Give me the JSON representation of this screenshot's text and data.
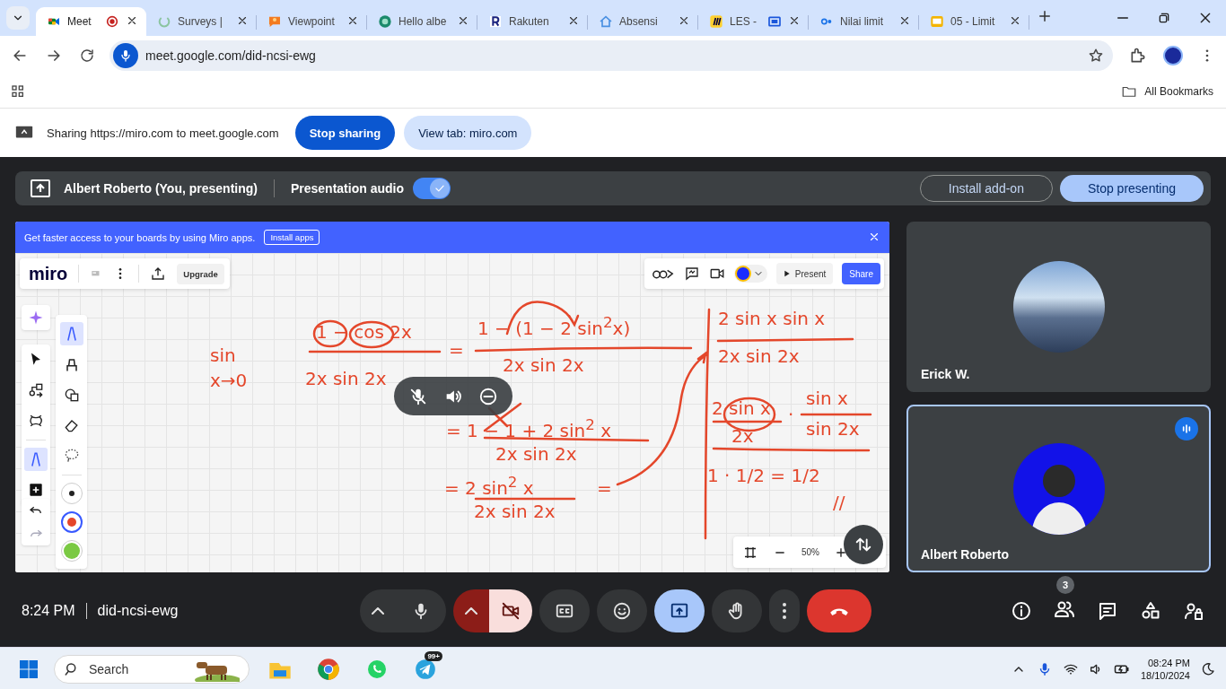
{
  "browser": {
    "tabs": [
      {
        "title": "Meet",
        "kind": "meet",
        "selected": true,
        "recording": true,
        "sharing": false
      },
      {
        "title": "Surveys |",
        "kind": "surveys",
        "selected": false,
        "recording": false,
        "sharing": false
      },
      {
        "title": "Viewpoint",
        "kind": "viewpoint",
        "selected": false,
        "recording": false,
        "sharing": false
      },
      {
        "title": "Hello albe",
        "kind": "hello",
        "selected": false,
        "recording": false,
        "sharing": false
      },
      {
        "title": "Rakuten",
        "kind": "rakuten",
        "selected": false,
        "recording": false,
        "sharing": false
      },
      {
        "title": "Absensi",
        "kind": "house",
        "selected": false,
        "recording": false,
        "sharing": false
      },
      {
        "title": "LES -",
        "kind": "miro",
        "selected": false,
        "recording": false,
        "sharing": true
      },
      {
        "title": "Nilai limit",
        "kind": "co",
        "selected": false,
        "recording": false,
        "sharing": false
      },
      {
        "title": "05 - Limit",
        "kind": "slides",
        "selected": false,
        "recording": false,
        "sharing": false
      }
    ],
    "address": "meet.google.com/did-ncsi-ewg",
    "bookmarks": "All Bookmarks"
  },
  "share_bar": {
    "text": "Sharing https://miro.com to meet.google.com",
    "buttons": [
      "Stop sharing",
      "View tab: miro.com"
    ]
  },
  "presenting_bar": {
    "presenter": "Albert Roberto (You, presenting)",
    "audio_label": "Presentation audio",
    "audio_on": true,
    "buttons": [
      "Install add-on",
      "Stop presenting"
    ]
  },
  "miro": {
    "banner": {
      "text": "Get faster access to your boards by using Miro apps.",
      "button": "Install apps"
    },
    "logo": "miro",
    "upgrade": "Upgrade",
    "present": "Present",
    "share": "Share",
    "zoom": "50%",
    "tools": [
      {
        "kind": "select",
        "selected": false
      },
      {
        "kind": "connect",
        "selected": false
      },
      {
        "kind": "frame",
        "selected": false
      },
      {
        "kind": "pen",
        "selected": true
      },
      {
        "kind": "add",
        "selected": false
      }
    ],
    "pen_tools": [
      {
        "kind": "pen",
        "selected": true
      },
      {
        "kind": "marker",
        "selected": false
      },
      {
        "kind": "shape",
        "selected": false
      },
      {
        "kind": "eraser",
        "selected": false
      },
      {
        "kind": "lasso",
        "selected": false
      }
    ],
    "pen_colors": [
      {
        "color": "#222222",
        "selected": false
      },
      {
        "color": "#e4472b",
        "selected": true
      },
      {
        "color": "#7ac943",
        "selected": false
      }
    ],
    "handwriting": [
      "sin",
      "x→0",
      "1 − cos 2x",
      "2x sin 2x",
      "=",
      "1 − (1 − 2 sin$^{2}$x)",
      "2x sin 2x",
      "= 1 − 1 + 2 sin$^{2}$ x",
      "2x sin 2x",
      "= 2 sin$^{2}$ x",
      "2x sin 2x",
      "=",
      "2 sin x sin x",
      "2x sin 2x",
      "2 sin x",
      "2x",
      "·",
      "sin x",
      "sin 2x",
      "1 · 1/2 = 1/2",
      "//"
    ]
  },
  "tiles": [
    {
      "name": "Erick W.",
      "speaking": false,
      "kind": "photo"
    },
    {
      "name": "Albert Roberto",
      "speaking": true,
      "kind": "person"
    }
  ],
  "bottom_bar": {
    "time": "8:24 PM",
    "meeting_code": "did-ncsi-ewg",
    "controls": [
      {
        "kind": "mic",
        "highlighted": false
      },
      {
        "kind": "camera",
        "highlighted": true
      },
      {
        "kind": "captions",
        "highlighted": false
      },
      {
        "kind": "emoji",
        "highlighted": false
      },
      {
        "kind": "present",
        "highlighted": true
      },
      {
        "kind": "hand",
        "highlighted": false
      },
      {
        "kind": "more",
        "highlighted": false
      },
      {
        "kind": "leave",
        "highlighted": true
      }
    ],
    "participants_count": "3"
  },
  "taskbar": {
    "search_placeholder": "Search",
    "telegram_badge": "99+",
    "time": "08:24 PM",
    "date": "18/10/2024"
  }
}
